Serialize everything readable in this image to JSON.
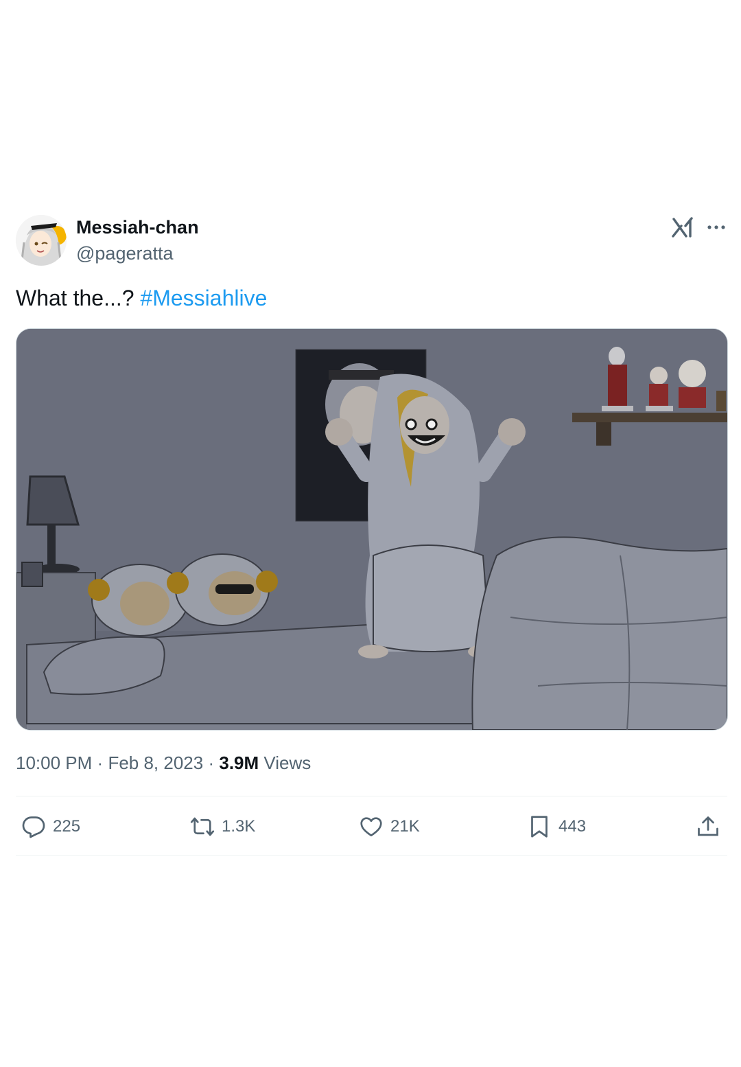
{
  "author": {
    "display_name": "Messiah-chan",
    "handle": "@pageratta",
    "avatar_icon": "anime-avatar"
  },
  "header": {
    "platform_icon": "x-logo-icon",
    "more_icon": "more-options-icon"
  },
  "tweet": {
    "text": "What the...?",
    "hashtag": "#Messiahlive",
    "image_description": ""
  },
  "meta": {
    "time": "10:00 PM",
    "separator": "·",
    "date": "Feb 8, 2023",
    "views_count": "3.9M",
    "views_label": "Views"
  },
  "actions": {
    "replies": "225",
    "reposts": "1.3K",
    "likes": "21K",
    "bookmarks": "443"
  },
  "colors": {
    "link": "#1d9bf0",
    "secondary_text": "#536471",
    "primary_text": "#0f1419",
    "divider": "#eff3f4"
  }
}
